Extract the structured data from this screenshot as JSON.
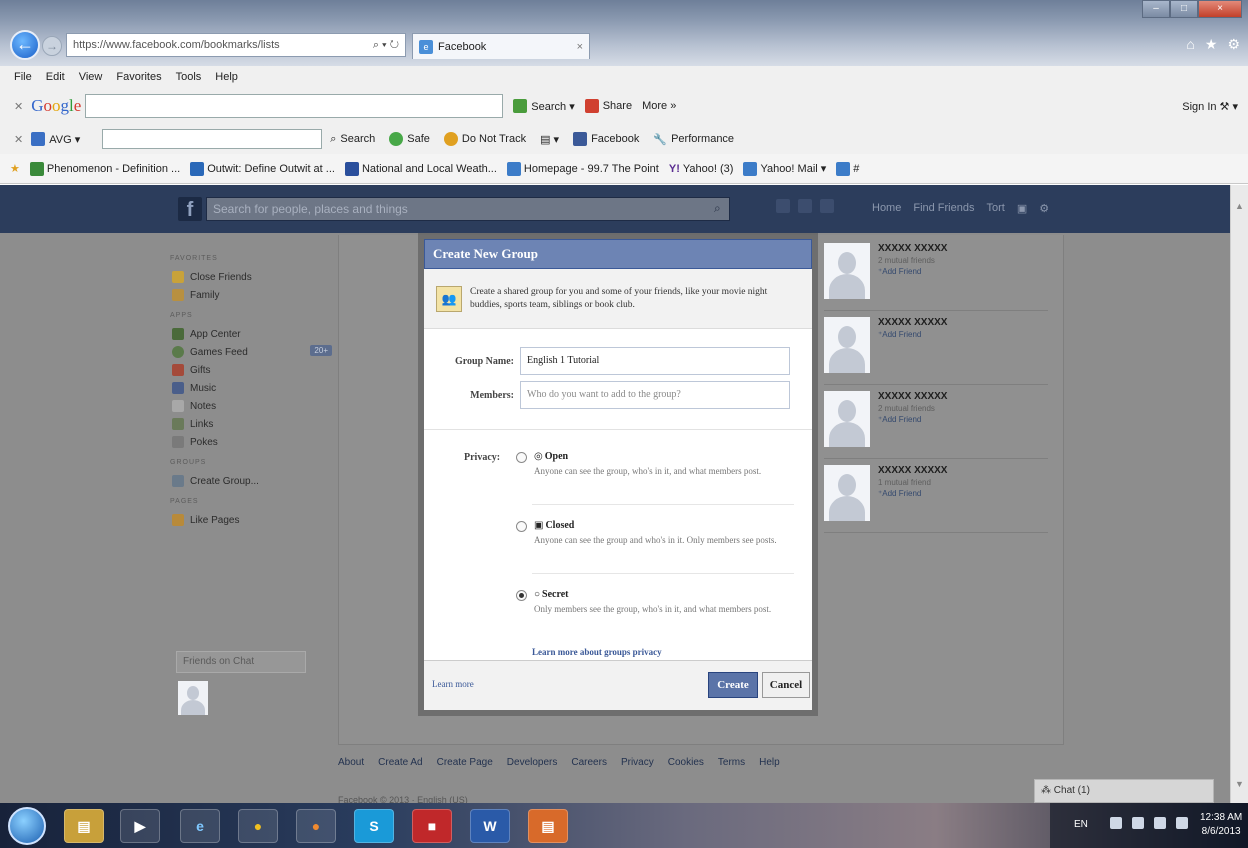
{
  "browser": {
    "url": "https://www.facebook.com/bookmarks/lists",
    "address_controls": "⌕ ▾ ↻",
    "tab_title": "Facebook",
    "tab_close": "×",
    "window_controls": [
      "–",
      "□",
      "×"
    ],
    "home_icons": [
      "⌂",
      "★",
      "⚙"
    ],
    "menu": [
      "File",
      "Edit",
      "View",
      "Favorites",
      "Tools",
      "Help"
    ],
    "google_toolbar": {
      "logo": [
        "G",
        "o",
        "o",
        "g",
        "l",
        "e"
      ],
      "search": "Search ▾",
      "share": "Share",
      "more": "More »",
      "sign_in": "Sign In ⚒ ▾"
    },
    "avg_toolbar": {
      "brand": "AVG ▾",
      "search": "Search",
      "safe": "Safe",
      "do_not_track": "Do Not Track",
      "facebook": "Facebook",
      "performance": "Performance"
    },
    "favorites": [
      "Phenomenon - Definition ...",
      "Outwit: Define Outwit at ...",
      "National and Local Weath...",
      "Homepage - 99.7 The Point",
      "Yahoo! (3)",
      "Yahoo! Mail ▾",
      "#"
    ]
  },
  "facebook": {
    "logo": "f",
    "search_placeholder": "Search for people, places and things",
    "top_nav": [
      "Home",
      "Find Friends",
      "Tort"
    ],
    "left_nav": {
      "favorites_heading": "FAVORITES",
      "favorites": [
        "Close Friends",
        "Family"
      ],
      "apps_heading": "APPS",
      "apps": [
        "App Center",
        "Games Feed",
        "Gifts",
        "Music",
        "Notes",
        "Links",
        "Pokes"
      ],
      "games_count": "20+",
      "groups_heading": "GROUPS",
      "groups": [
        "Create Group..."
      ],
      "pages_heading": "PAGES",
      "pages": [
        "Like Pages"
      ],
      "friends_on_chat": "Friends on Chat"
    },
    "suggestions": [
      {
        "name": "XXXXX XXXXX",
        "mutual": "2 mutual friends",
        "add": "Add Friend"
      },
      {
        "name": "XXXXX XXXXX",
        "mutual": "",
        "add": "Add Friend"
      },
      {
        "name": "XXXXX XXXXX",
        "mutual": "2 mutual friends",
        "add": "Add Friend"
      },
      {
        "name": "XXXXX XXXXX",
        "mutual": "1 mutual friend",
        "add": "Add Friend"
      }
    ],
    "footer_links": [
      "About",
      "Create Ad",
      "Create Page",
      "Developers",
      "Careers",
      "Privacy",
      "Cookies",
      "Terms",
      "Help"
    ],
    "copyright": "Facebook © 2013 · English (US)",
    "chat": "Chat (1)"
  },
  "modal": {
    "title": "Create New Group",
    "intro": "Create a shared group for you and some of your friends, like your movie night buddies, sports team, siblings or book club.",
    "group_name_label": "Group Name:",
    "group_name_value": "English 1 Tutorial",
    "members_label": "Members:",
    "members_placeholder": "Who do you want to add to the group?",
    "privacy_label": "Privacy:",
    "options": [
      {
        "title": "Open",
        "glyph": "◎",
        "desc": "Anyone can see the group, who's in it, and what members post.",
        "selected": false
      },
      {
        "title": "Closed",
        "glyph": "▣",
        "desc": "Anyone can see the group and who's in it. Only members see posts.",
        "selected": false
      },
      {
        "title": "Secret",
        "glyph": "○",
        "desc": "Only members see the group, who's in it, and what members post.",
        "selected": true
      }
    ],
    "learn_privacy": "Learn more about groups privacy",
    "learn_more": "Learn more",
    "create": "Create",
    "cancel": "Cancel"
  },
  "taskbar": {
    "apps": [
      "e",
      "●",
      "●",
      "S",
      "■",
      "W",
      "▤"
    ],
    "lang": "EN",
    "time": "12:38 AM",
    "date": "8/6/2013"
  },
  "colors": {
    "fb_blue": "#3b5998",
    "fb_header": "#2c3d5c",
    "overlay": "#8d8d8d",
    "modal_header": "#6d84b4"
  }
}
